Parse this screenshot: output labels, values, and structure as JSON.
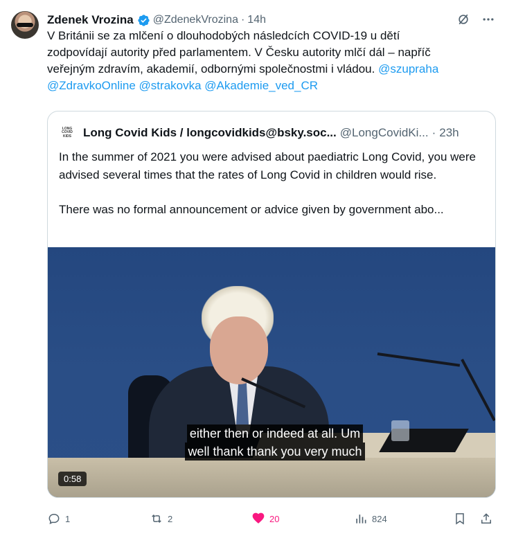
{
  "tweet": {
    "author_name": "Zdenek Vrozina",
    "author_handle": "@ZdenekVrozina",
    "separator": "·",
    "time": "14h",
    "text_lines": [
      "V Británii se za mlčení o dlouhodobých následcích COVID-19 u dětí",
      "zodpovídají autority před parlamentem. V Česku autority mlčí dál – napříč",
      "veřejným zdravím, akademií, odbornými společnostmi i vládou."
    ],
    "mentions": [
      "@szupraha",
      "@ZdravkoOnline",
      "@strakovka",
      "@Akademie_ved_CR"
    ]
  },
  "quote": {
    "logo_text": [
      "LONG",
      "COVID",
      "KIDS"
    ],
    "author_name": "Long Covid Kids / longcovidkids@bsky.soc...",
    "author_handle": "@LongCovidKi...",
    "separator": "·",
    "time": "23h",
    "paragraph1": "In the summer of 2021 you were advised about paediatric Long Covid, you were advised several times that the rates of Long Covid in children would rise.",
    "paragraph2": "There was no formal announcement or advice given by government abo...",
    "video": {
      "caption_line1": "either then or indeed at all. Um",
      "caption_line2": "well thank thank you very much",
      "duration": "0:58"
    }
  },
  "actions": {
    "replies": "1",
    "reposts": "2",
    "likes": "20",
    "views": "824"
  },
  "colors": {
    "link": "#1d9bf0",
    "muted": "#536471",
    "like": "#f91880",
    "verified": "#1d9bf0"
  },
  "icons": [
    "verified-badge-icon",
    "grok-icon",
    "more-icon",
    "reply-icon",
    "repost-icon",
    "like-icon",
    "views-icon",
    "bookmark-icon",
    "share-icon"
  ]
}
